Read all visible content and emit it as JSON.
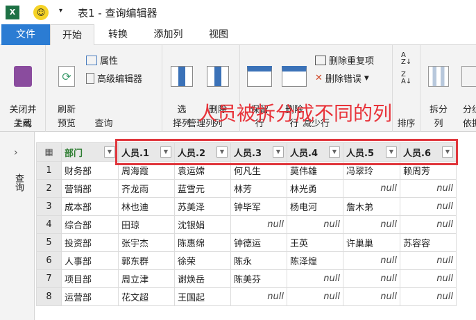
{
  "window": {
    "title": "表1 - 查询编辑器"
  },
  "tabs": [
    "文件",
    "开始",
    "转换",
    "添加列",
    "视图"
  ],
  "ribbon": {
    "close_group": {
      "label": "关闭",
      "button": "关闭并\n上载"
    },
    "query_group": {
      "label": "查询",
      "refresh": "刷新\n预览",
      "properties": "属性",
      "advanced": "高级编辑器"
    },
    "manage_group": {
      "label": "管理列",
      "choose": "选\n择列",
      "remove": "删除\n列"
    },
    "reduce_group": {
      "label": "减少行",
      "keep": "保留\n行",
      "remove": "删除\n行",
      "remove_dup": "删除重复项",
      "remove_err": "删除错误"
    },
    "sort_group": {
      "label": "排序"
    },
    "split": {
      "label": "拆分\n列"
    },
    "groupby": {
      "label": "分组\n依据"
    }
  },
  "sidebar": {
    "label": "查询"
  },
  "annotation": "人员被拆分成不同的列",
  "table": {
    "headers": [
      "部门",
      "人员.1",
      "人员.2",
      "人员.3",
      "人员.4",
      "人员.5",
      "人员.6"
    ],
    "rows": [
      [
        "财务部",
        "周海霞",
        "袁运嫦",
        "何凡生",
        "莫伟雄",
        "冯翠玲",
        "赖周芳"
      ],
      [
        "营销部",
        "齐龙雨",
        "蓝雪元",
        "林芳",
        "林光勇",
        "null",
        "null"
      ],
      [
        "成本部",
        "林也迪",
        "苏美泽",
        "钟毕军",
        "杨电河",
        "詹木弟",
        "null"
      ],
      [
        "综合部",
        "田琼",
        "沈银娟",
        "null",
        "null",
        "null",
        "null"
      ],
      [
        "投资部",
        "张宇杰",
        "陈惠绵",
        "钟德运",
        "王英",
        "许巢巢",
        "苏容容"
      ],
      [
        "人事部",
        "郭东群",
        "徐荣",
        "陈永",
        "陈泽煌",
        "null",
        "null"
      ],
      [
        "项目部",
        "周立津",
        "谢焕岳",
        "陈美芬",
        "null",
        "null",
        "null"
      ],
      [
        "运营部",
        "花文超",
        "王国起",
        "null",
        "null",
        "null",
        "null"
      ]
    ]
  },
  "colors": {
    "file_tab": "#2b7cd3",
    "annotation": "#e8333a"
  }
}
